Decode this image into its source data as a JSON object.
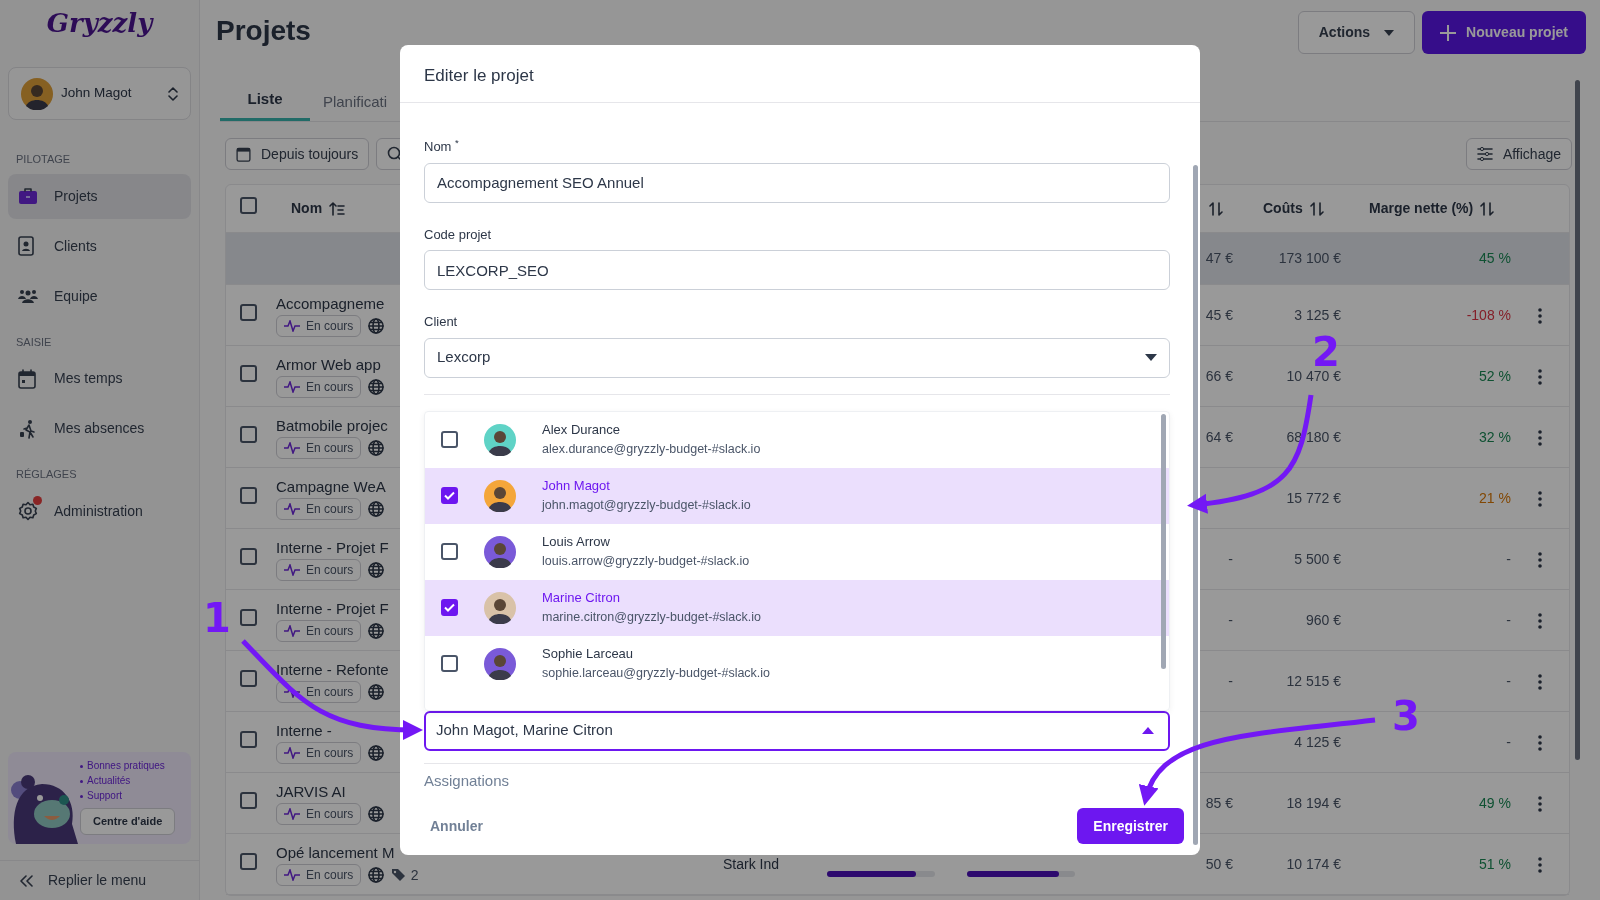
{
  "app": {
    "logo": "Gryzzly",
    "user": "John Magot",
    "collapse": "Replier le menu"
  },
  "sidebar": {
    "sections": [
      {
        "title": "PILOTAGE",
        "items": [
          {
            "label": "Projets",
            "selected": true,
            "notification": false
          },
          {
            "label": "Clients",
            "selected": false,
            "notification": false
          },
          {
            "label": "Equipe",
            "selected": false,
            "notification": false
          }
        ]
      },
      {
        "title": "SAISIE",
        "items": [
          {
            "label": "Mes temps",
            "selected": false,
            "notification": false
          },
          {
            "label": "Mes absences",
            "selected": false,
            "notification": false
          }
        ]
      },
      {
        "title": "RÉGLAGES",
        "items": [
          {
            "label": "Administration",
            "selected": false,
            "notification": true
          }
        ]
      }
    ]
  },
  "help": {
    "links": [
      "Bonnes pratiques",
      "Actualités",
      "Support"
    ],
    "button": "Centre d'aide"
  },
  "page": {
    "title": "Projets",
    "actions": "Actions",
    "new_button": "Nouveau projet"
  },
  "tabs": [
    {
      "label": "Liste",
      "selected": true
    },
    {
      "label": "Planificati",
      "selected": false
    }
  ],
  "filters": {
    "period": "Depuis toujours",
    "display": "Affichage"
  },
  "table": {
    "columns": [
      "Nom",
      "Coûts",
      "Marge nette (%)"
    ],
    "all_checked": false,
    "summary": {
      "column_6": "47 €",
      "costs": "173 100 €",
      "margin": {
        "text": "45 %",
        "kind": "positive"
      }
    },
    "rows": [
      {
        "checked": false,
        "name": "Accompagneme",
        "status": "En cours",
        "column_6": "45 €",
        "costs": "3 125 €",
        "margin": {
          "text": "-108 %",
          "kind": "negative"
        }
      },
      {
        "checked": false,
        "name": "Armor Web app",
        "status": "En cours",
        "column_6": "66 €",
        "costs": "10 470 €",
        "margin": {
          "text": "52 %",
          "kind": "positive"
        }
      },
      {
        "checked": false,
        "name": "Batmobile projec",
        "status": "En cours",
        "column_6": "64 €",
        "costs": "68 180 €",
        "margin": {
          "text": "32 %",
          "kind": "positive"
        }
      },
      {
        "checked": false,
        "name": "Campagne WeA",
        "status": "En cours",
        "costs": "15 772 €",
        "margin": {
          "text": "21 %",
          "kind": "warning"
        }
      },
      {
        "checked": false,
        "name": "Interne - Projet F",
        "status": "En cours",
        "column_6": "-",
        "costs": "5 500 €",
        "margin": {
          "text": "-"
        }
      },
      {
        "checked": false,
        "name": "Interne - Projet F",
        "status": "En cours",
        "column_6": "-",
        "costs": "960 €",
        "margin": {
          "text": "-"
        }
      },
      {
        "checked": false,
        "name": "Interne - Refonte",
        "status": "En cours",
        "column_6": "-",
        "costs": "12 515 €",
        "margin": {
          "text": "-"
        }
      },
      {
        "checked": false,
        "name": "Interne -",
        "status": "En cours",
        "costs": "4 125 €",
        "margin": {
          "text": "-"
        }
      },
      {
        "checked": false,
        "name": "JARVIS AI",
        "status": "En cours",
        "column_6": "85 €",
        "costs": "18 194 €",
        "margin": {
          "text": "49 %",
          "kind": "positive"
        }
      },
      {
        "checked": false,
        "name": "Opé lancement M",
        "status": "En cours",
        "tags": "2",
        "client": "Stark Ind",
        "time": {
          "level": 0.82
        },
        "budget": {
          "level": 0.85
        },
        "column_6": "50 €",
        "costs": "10 174 €",
        "margin": {
          "text": "51 %",
          "kind": "positive"
        }
      }
    ]
  },
  "modal": {
    "title": "Editer le projet",
    "fields": [
      {
        "kind": "input",
        "label": "Nom $^{*}$",
        "value": "Accompagnement SEO Annuel"
      },
      {
        "kind": "input",
        "label": "Code projet",
        "value": "LEXCORP_SEO"
      },
      {
        "kind": "select",
        "label": "Client",
        "value": "Lexcorp",
        "expanded": false
      }
    ],
    "members": [
      {
        "name": "Alex Durance",
        "email": "alex.durance@gryzzly-budget-#slack.io",
        "checked": false,
        "color": "#5fd3c6"
      },
      {
        "name": "John Magot",
        "email": "john.magot@gryzzly-budget-#slack.io",
        "checked": true,
        "color": "#f4a63a"
      },
      {
        "name": "Louis Arrow",
        "email": "louis.arrow@gryzzly-budget-#slack.io",
        "checked": false,
        "color": "#7a5ad8"
      },
      {
        "name": "Marine Citron",
        "email": "marine.citron@gryzzly-budget-#slack.io",
        "checked": true,
        "color": "#d9c2a8"
      },
      {
        "name": "Sophie Larceau",
        "email": "sophie.larceau@gryzzly-budget-#slack.io",
        "checked": false,
        "color": "#7a5ad8"
      }
    ],
    "members_field": {
      "value": "John Magot, Marine Citron",
      "expanded": true
    },
    "section": "Assignations",
    "cancel": "Annuler",
    "save": "Enregistrer"
  },
  "annotations": [
    {
      "label": "1"
    },
    {
      "label": "2"
    },
    {
      "label": "3"
    }
  ]
}
